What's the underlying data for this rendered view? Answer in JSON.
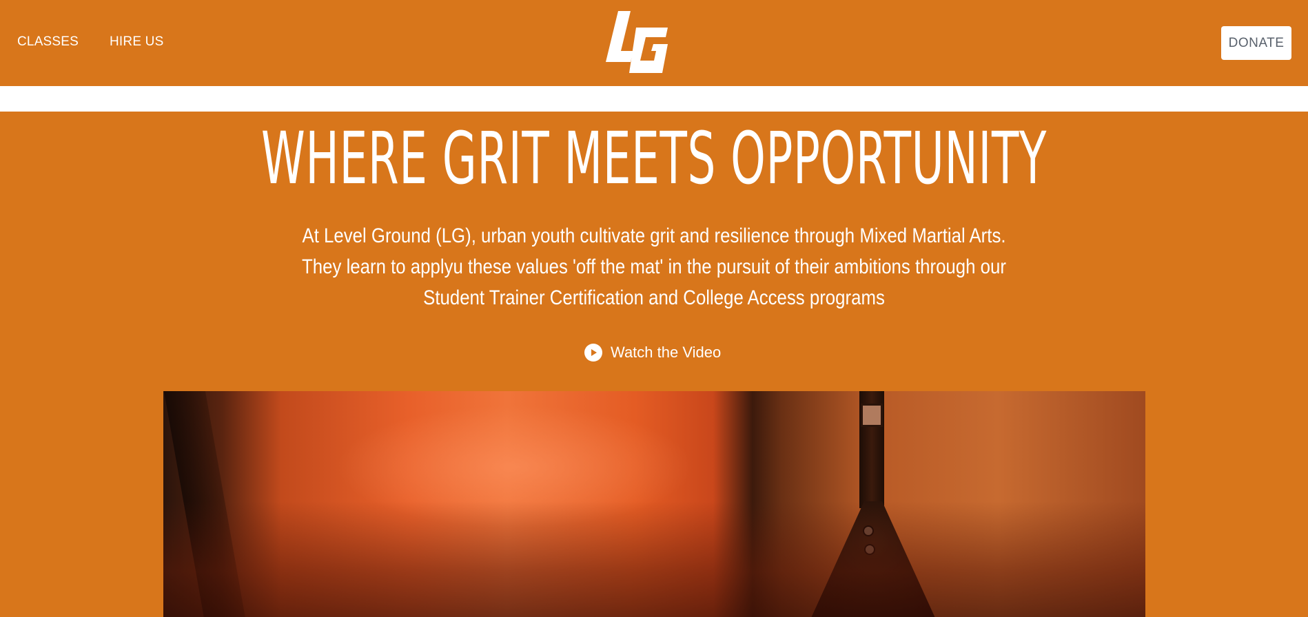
{
  "nav": {
    "classes_label": "CLASSES",
    "hire_label": "HIRE US",
    "donate_label": "DONATE"
  },
  "logo": {
    "text": "LG"
  },
  "hero": {
    "title": "WHERE GRIT MEETS OPPORTUNITY",
    "subtitle": "At Level Ground (LG), urban youth cultivate grit and resilience through Mixed Martial Arts. They learn to applyu these values 'off the mat' in the pursuit of their ambitions through our Student Trainer Certification and College Access programs",
    "watch_label": "Watch the Video"
  },
  "colors": {
    "brand_orange": "#d8761b",
    "white": "#ffffff",
    "donate_text": "#58606b"
  },
  "icons": {
    "play": "play-circle-icon"
  }
}
